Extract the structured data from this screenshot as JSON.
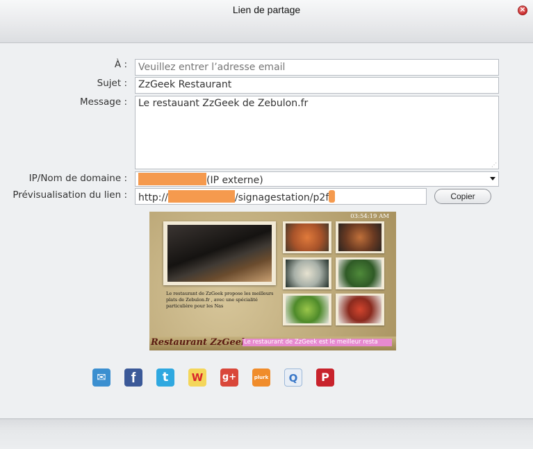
{
  "dialog": {
    "title": "Lien de partage",
    "close_icon": "close-icon"
  },
  "form": {
    "to_label": "À :",
    "to_placeholder": "Veuillez entrer l’adresse email",
    "subject_label": "Sujet :",
    "subject_value": "ZzGeek Restaurant",
    "message_label": "Message :",
    "message_value": "Le restauant ZzGeek de Zebulon.fr",
    "ip_label": "IP/Nom de domaine :",
    "ip_value_suffix": "(IP externe)",
    "preview_label": "Prévisualisation du lien :",
    "preview_prefix": "http://",
    "preview_suffix": "/signagestation/p2f",
    "copy_label": "Copier"
  },
  "preview": {
    "clock": "03:54:19 AM",
    "description": "Le restaurant de ZzGeek propose les meilleurs plats de Zebulon.fr , avec une spécialité particulière pour les Nas",
    "restaurant_name": "Restaurant ZzGeek",
    "ticker": "Le restaurant de ZzGeek est le meilleur resta"
  },
  "share_icons": [
    {
      "name": "email-icon",
      "glyph": "✉",
      "color": "#3b8fd0"
    },
    {
      "name": "facebook-icon",
      "glyph": "f",
      "color": "#3b5998"
    },
    {
      "name": "twitter-icon",
      "glyph": "t",
      "color": "#2fa8e0"
    },
    {
      "name": "weibo-icon",
      "glyph": "W",
      "color": "#e6a21f"
    },
    {
      "name": "google-plus-icon",
      "glyph": "g+",
      "color": "#d9473a"
    },
    {
      "name": "plurk-icon",
      "glyph": "plurk",
      "color": "#f08c2b"
    },
    {
      "name": "qzone-icon",
      "glyph": "Q",
      "color": "#4a8fd8"
    },
    {
      "name": "pinterest-icon",
      "glyph": "P",
      "color": "#c8232c"
    }
  ],
  "colors": {
    "redaction": "#f59a4e",
    "ticker_bg": "#e78ad0"
  }
}
